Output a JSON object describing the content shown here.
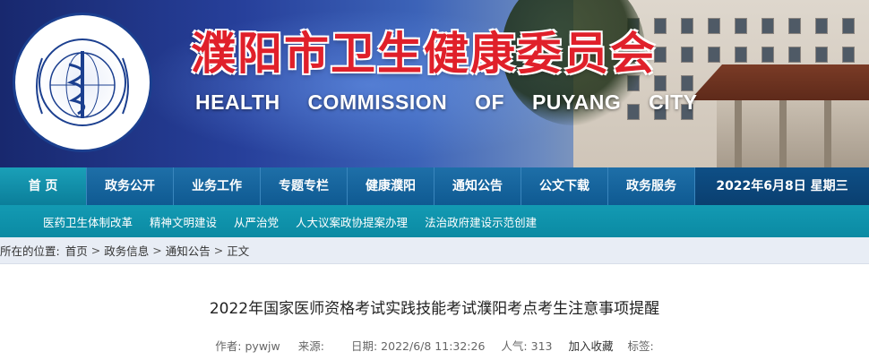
{
  "header": {
    "title": "濮阳市卫生健康委员会",
    "subtitle": "HEALTH COMMISSION OF PUYANG CITY",
    "logo_text": "濮阳市卫生健康委员会",
    "logo_text_en": "Health commission of PUYang City"
  },
  "nav": {
    "items": [
      "首 页",
      "政务公开",
      "业务工作",
      "专题专栏",
      "健康濮阳",
      "通知公告",
      "公文下载",
      "政务服务"
    ],
    "date": "2022年6月8日 星期三"
  },
  "subnav": {
    "items": [
      "医药卫生体制改革",
      "精神文明建设",
      "从严治党",
      "人大议案政协提案办理",
      "法治政府建设示范创建"
    ]
  },
  "breadcrumb": {
    "lead": "所在的位置:",
    "items": [
      "首页",
      "政务信息",
      "通知公告",
      "正文"
    ],
    "separator": ">"
  },
  "article": {
    "title": "2022年国家医师资格考试实践技能考试濮阳考点考生注意事项提醒",
    "author_label": "作者:",
    "author": "pywjw",
    "source_label": "来源:",
    "source": "",
    "date_label": "日期:",
    "date": "2022/6/8 11:32:26",
    "views_label": "人气:",
    "views": "313",
    "favorite_label": "加入收藏",
    "tags_label": "标签:"
  },
  "colors": {
    "nav_bg": "#0f5a92",
    "nav_home_bg": "#0b7e9a",
    "subnav_bg": "#0b8aa3",
    "title_red": "#e0202a",
    "logo_blue": "#1b3f8f"
  }
}
